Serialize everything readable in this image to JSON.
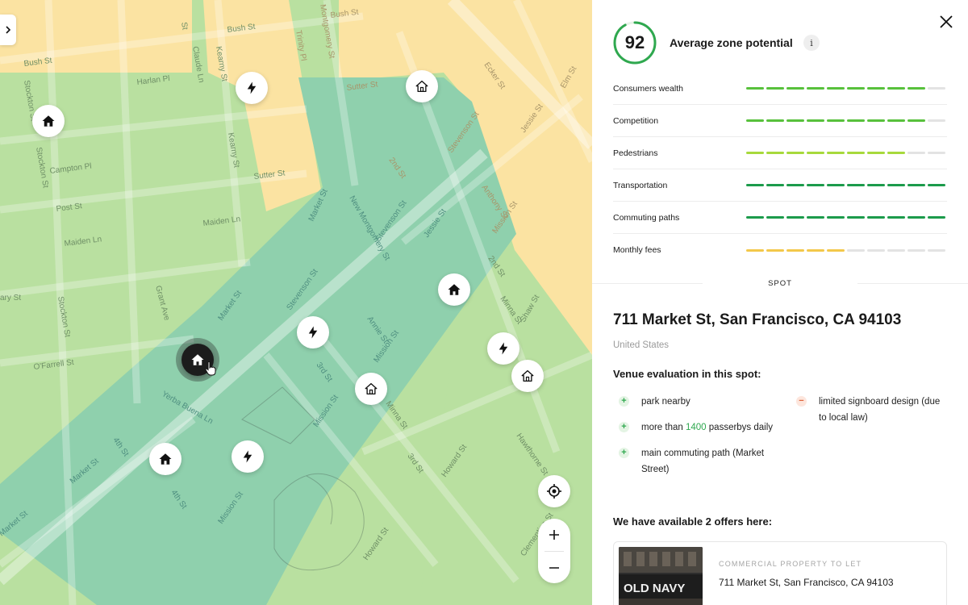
{
  "map": {
    "street_labels": {
      "bush_st": "Bush St",
      "kearny_st": "Kearny St",
      "claude_ln": "Claude Ln",
      "trinity_pl": "Trinity Pl",
      "montgomery_st": "Montgomery St",
      "harlan_pl": "Harlan Pl",
      "sutter_st": "Sutter St",
      "stockton_st": "Stockton St",
      "campton_pl": "Campton Pl",
      "post_st": "Post St",
      "maiden_ln": "Maiden Ln",
      "market_st": "Market St",
      "new_montgomery_st": "New Montgomery St",
      "stevenson_st": "Stevenson St",
      "jessie_st": "Jessie St",
      "mission_st": "Mission St",
      "second_st": "2nd St",
      "third_st": "3rd St",
      "fourth_st": "4th St",
      "grant_ave": "Grant Ave",
      "ofarrell_st": "O'Farrell St",
      "yerba_buena_ln": "Yerba Buena Ln",
      "annie_st": "Annie St",
      "minna_st": "Minna St",
      "howard_st": "Howard St",
      "clementina_st": "Clementina St",
      "hawthorne_st": "Hawthorne St",
      "ecker_st": "Ecker St",
      "elm_st": "Elm St",
      "anthony_st": "Anthony St",
      "shaw_st": "Shaw St",
      "ary_st": "ary St",
      "st_fragment": "St"
    },
    "markers": [
      {
        "name": "map-marker-home-1",
        "icon": "house-icon"
      },
      {
        "name": "map-marker-bolt-1",
        "icon": "lightning-icon"
      },
      {
        "name": "map-marker-home-2",
        "icon": "house-outline-icon"
      },
      {
        "name": "map-marker-home-3",
        "icon": "house-icon"
      },
      {
        "name": "map-marker-bolt-2",
        "icon": "lightning-icon"
      },
      {
        "name": "map-marker-bolt-3",
        "icon": "lightning-icon"
      },
      {
        "name": "map-marker-home-4",
        "icon": "house-outline-icon"
      },
      {
        "name": "map-marker-home-active",
        "icon": "house-icon"
      },
      {
        "name": "map-marker-home-5",
        "icon": "house-outline-icon"
      },
      {
        "name": "map-marker-home-6",
        "icon": "house-icon"
      },
      {
        "name": "map-marker-bolt-4",
        "icon": "lightning-icon"
      }
    ],
    "zone_colors": {
      "low": "#fbe3a2",
      "mid": "#b9e0a0",
      "high": "#8fd0ad"
    },
    "controls": {
      "zoom_in": "+",
      "zoom_out": "−"
    }
  },
  "panel": {
    "score": {
      "value": "92",
      "fraction": 0.92,
      "title": "Average zone potential",
      "info": "i",
      "ring_color": "#2fa84f"
    },
    "metrics": [
      {
        "label": "Consumers wealth",
        "filled": 9,
        "total": 10,
        "color": "#58c13c"
      },
      {
        "label": "Competition",
        "filled": 9,
        "total": 10,
        "color": "#58c13c"
      },
      {
        "label": "Pedestrians",
        "filled": 8,
        "total": 10,
        "color": "#a7d93c"
      },
      {
        "label": "Transportation",
        "filled": 10,
        "total": 10,
        "color": "#1c9b4b"
      },
      {
        "label": "Commuting paths",
        "filled": 10,
        "total": 10,
        "color": "#1c9b4b"
      },
      {
        "label": "Monthly fees",
        "filled": 5,
        "total": 10,
        "color": "#f3c84a"
      }
    ],
    "section_label": "SPOT",
    "address": "711 Market St, San Francisco, CA 94103",
    "country": "United States",
    "evaluation": {
      "title": "Venue evaluation in this spot:",
      "pros": [
        {
          "mark": "+",
          "text": "park nearby"
        },
        {
          "mark": "+",
          "text_before": "more than ",
          "highlight": "1400",
          "text_after": " passerbys daily"
        },
        {
          "mark": "+",
          "text": "main commuting path (Market Street)"
        }
      ],
      "cons": [
        {
          "mark": "−",
          "text": "limited signboard design (due to local law)"
        }
      ]
    },
    "offers": {
      "title": "We have available 2 offers here:",
      "items": [
        {
          "type": "COMMERCIAL PROPERTY TO LET",
          "address": "711 Market St, San Francisco, CA 94103",
          "image_text": "OLD NAVY"
        }
      ]
    }
  }
}
